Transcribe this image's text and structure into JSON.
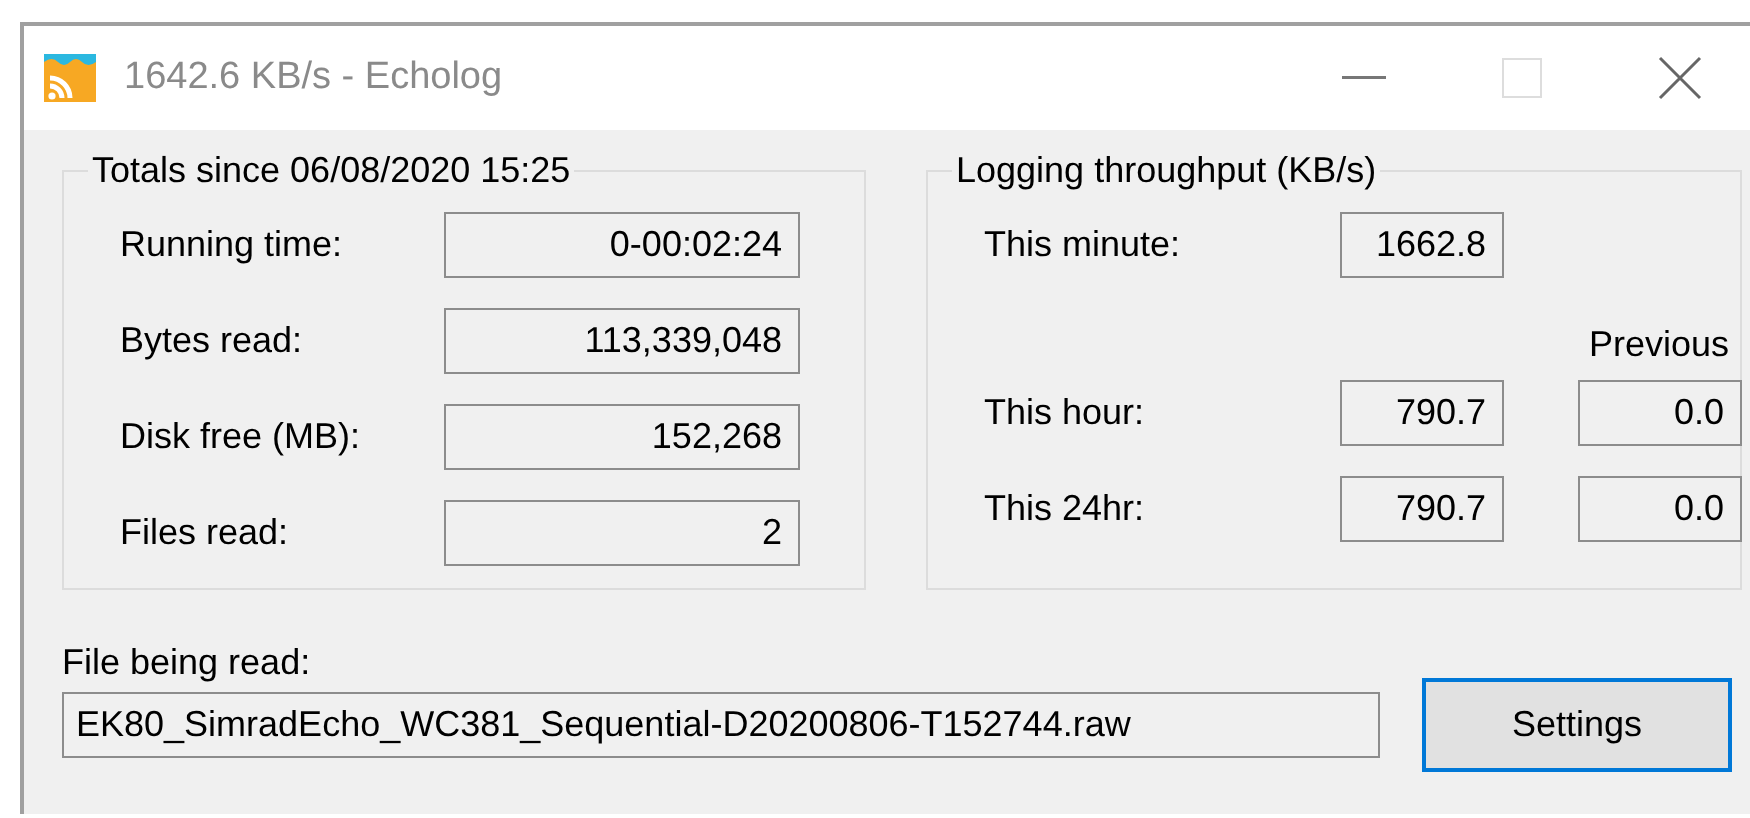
{
  "window": {
    "title": "1642.6 KB/s - Echolog"
  },
  "totals": {
    "heading": "Totals since 06/08/2020 15:25",
    "rows": [
      {
        "label": "Running time:",
        "value": "0-00:02:24"
      },
      {
        "label": "Bytes read:",
        "value": "113,339,048"
      },
      {
        "label": "Disk free (MB):",
        "value": "152,268"
      },
      {
        "label": "Files read:",
        "value": "2"
      }
    ]
  },
  "throughput": {
    "heading": "Logging throughput (KB/s)",
    "previous_label": "Previous",
    "rows": [
      {
        "label": "This minute:",
        "value": "1662.8"
      },
      {
        "label": "This hour:",
        "value": "790.7",
        "previous": "0.0"
      },
      {
        "label": "This 24hr:",
        "value": "790.7",
        "previous": "0.0"
      }
    ]
  },
  "file": {
    "label": "File being read:",
    "value": "EK80_SimradEcho_WC381_Sequential-D20200806-T152744.raw"
  },
  "buttons": [
    {
      "label": "Settings",
      "focused": true
    }
  ]
}
